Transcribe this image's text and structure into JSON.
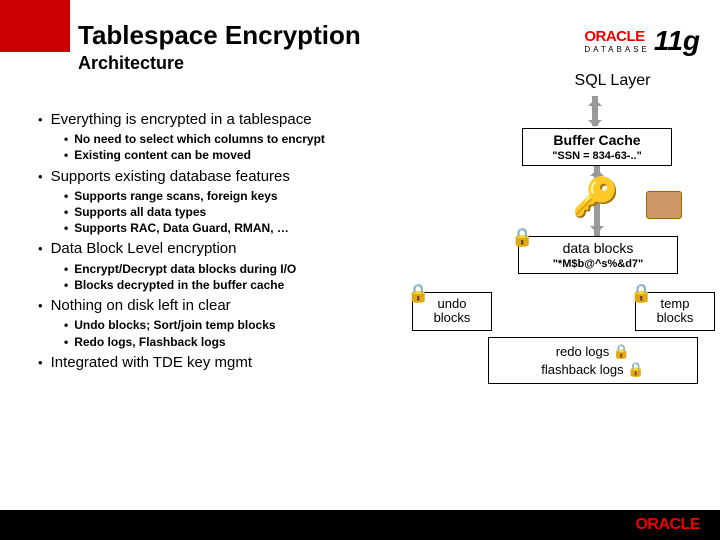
{
  "header": {
    "title": "Tablespace Encryption",
    "subtitle": "Architecture"
  },
  "logo": {
    "brand": "ORACLE",
    "product": "DATABASE",
    "version": "11g"
  },
  "bullets": {
    "b1": "Everything is encrypted in a tablespace",
    "b1a": "No need to select which columns to encrypt",
    "b1b": "Existing content can be moved",
    "b2": "Supports existing database features",
    "b2a": "Supports range scans, foreign keys",
    "b2b": "Supports all data types",
    "b2c": "Supports RAC, Data Guard, RMAN, …",
    "b3": "Data Block Level encryption",
    "b3a": "Encrypt/Decrypt data blocks during I/O",
    "b3b": "Blocks decrypted in the buffer cache",
    "b4": "Nothing on disk left in clear",
    "b4a": "Undo blocks; Sort/join temp blocks",
    "b4b": "Redo logs, Flashback logs",
    "b5": "Integrated with TDE key mgmt"
  },
  "diagram": {
    "sql_layer": "SQL Layer",
    "buffer_cache": "Buffer Cache",
    "ssn": "\"SSN = 834-63-..\"",
    "data_blocks": "data blocks",
    "cipher": "\"*M$b@^s%&d7\"",
    "undo": "undo blocks",
    "temp": "temp blocks",
    "redo": "redo logs",
    "flashback": "flashback logs"
  },
  "icons": {
    "key": "🔑",
    "lock": "🔒"
  }
}
